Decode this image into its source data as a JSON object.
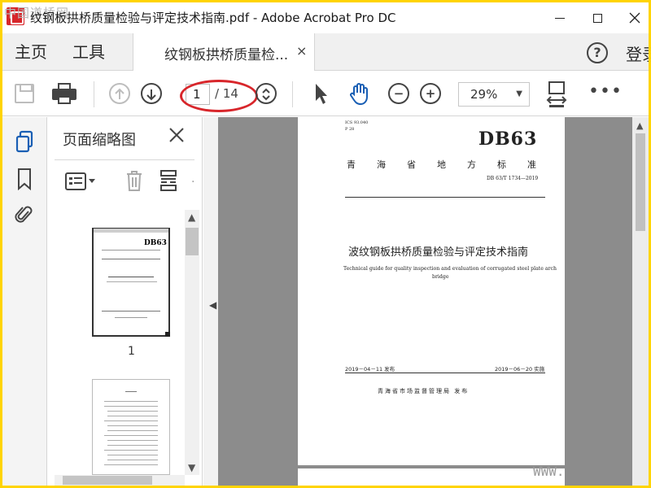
{
  "window": {
    "title": "纹钢板拱桥质量检验与评定技术指南.pdf - Adobe Acrobat Pro DC",
    "watermark_top": "中国道桥网",
    "watermark_bottom": "WWW."
  },
  "tabs": {
    "home": "主页",
    "tools": "工具",
    "document": "纹钢板拱桥质量检...",
    "close": "×",
    "signin": "登录"
  },
  "toolbar": {
    "current_page": "1",
    "total_pages": "/ 14",
    "zoom": "29%",
    "more": "•••",
    "highlight_color": "#d8262b"
  },
  "thumbnails": {
    "title": "页面缩略图",
    "page_1_label": "1",
    "thumb_logo": "DB63"
  },
  "document": {
    "ics": "ICS 93.040",
    "p_code": "P 28",
    "logo": "DB63",
    "province": "青海省地方标准",
    "standard_number": "DB 63/T 1734—2019",
    "title_cn": "波纹钢板拱桥质量检验与评定技术指南",
    "title_en_line1": "Technical guide for quality inspection and evaluation of corrugated steel plate arch",
    "title_en_line2": "bridge",
    "issue_date": "2019－04－11 发布",
    "implement_date": "2019－06－20 实施",
    "publisher": "青海省市场监督管理局    发布"
  },
  "colors": {
    "frame_border": "#ffd400",
    "adobe_red": "#d7262b",
    "canvas_gray": "#8c8c8c"
  }
}
